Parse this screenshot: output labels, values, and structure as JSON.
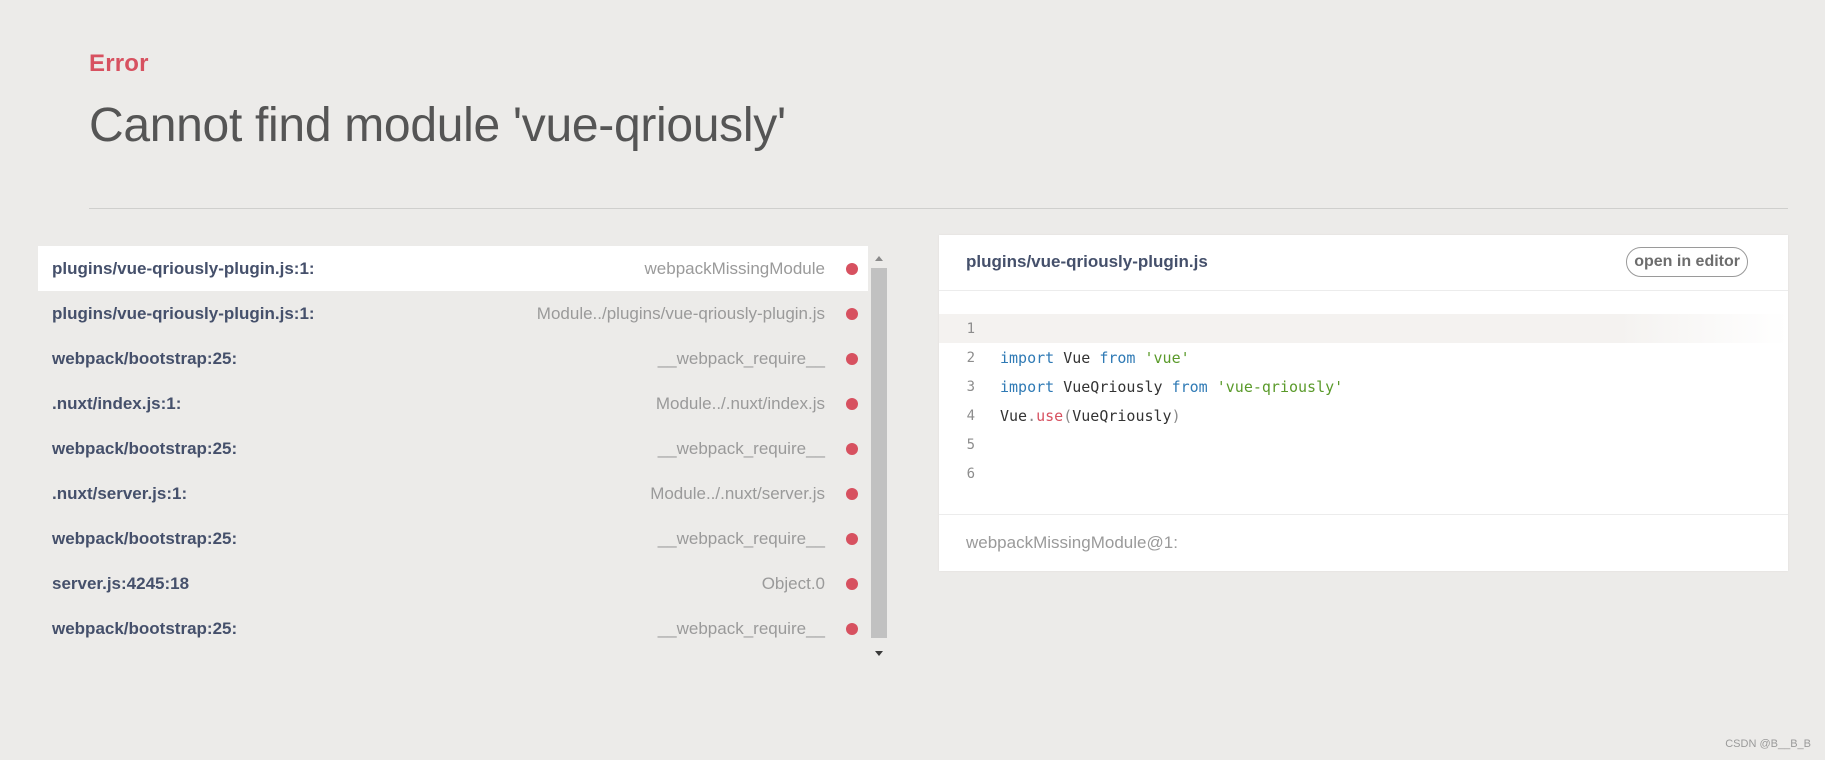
{
  "error": {
    "label": "Error",
    "message": "Cannot find module 'vue-qriously'"
  },
  "stack": [
    {
      "file": "plugins/vue-qriously-plugin.js:1:",
      "fn": "webpackMissingModule",
      "active": true
    },
    {
      "file": "plugins/vue-qriously-plugin.js:1:",
      "fn": "Module../plugins/vue-qriously-plugin.js",
      "active": false
    },
    {
      "file": "webpack/bootstrap:25:",
      "fn": "__webpack_require__",
      "active": false
    },
    {
      "file": ".nuxt/index.js:1:",
      "fn": "Module../.nuxt/index.js",
      "active": false
    },
    {
      "file": "webpack/bootstrap:25:",
      "fn": "__webpack_require__",
      "active": false
    },
    {
      "file": ".nuxt/server.js:1:",
      "fn": "Module../.nuxt/server.js",
      "active": false
    },
    {
      "file": "webpack/bootstrap:25:",
      "fn": "__webpack_require__",
      "active": false
    },
    {
      "file": "server.js:4245:18",
      "fn": "Object.0",
      "active": false
    },
    {
      "file": "webpack/bootstrap:25:",
      "fn": "__webpack_require__",
      "active": false
    }
  ],
  "code": {
    "filename": "plugins/vue-qriously-plugin.js",
    "open_editor_label": "open in editor",
    "lines": [
      {
        "no": "1",
        "tokens": []
      },
      {
        "no": "2",
        "tokens": [
          {
            "t": "import",
            "c": "kw"
          },
          {
            "t": " Vue ",
            "c": ""
          },
          {
            "t": "from",
            "c": "kw"
          },
          {
            "t": " ",
            "c": ""
          },
          {
            "t": "'vue'",
            "c": "str"
          }
        ]
      },
      {
        "no": "3",
        "tokens": [
          {
            "t": "import",
            "c": "kw"
          },
          {
            "t": " VueQriously ",
            "c": ""
          },
          {
            "t": "from",
            "c": "kw"
          },
          {
            "t": " ",
            "c": ""
          },
          {
            "t": "'vue-qriously'",
            "c": "str"
          }
        ]
      },
      {
        "no": "4",
        "tokens": [
          {
            "t": "Vue",
            "c": ""
          },
          {
            "t": ".",
            "c": "punc"
          },
          {
            "t": "use",
            "c": "fn"
          },
          {
            "t": "(",
            "c": "punc"
          },
          {
            "t": "VueQriously",
            "c": ""
          },
          {
            "t": ")",
            "c": "punc"
          }
        ]
      },
      {
        "no": "5",
        "tokens": []
      },
      {
        "no": "6",
        "tokens": []
      }
    ],
    "footer": "webpackMissingModule@1:"
  },
  "watermark": "CSDN @B__B_B",
  "colors": {
    "error_red": "#d75160",
    "keyword_blue": "#2f7ab5",
    "string_green": "#5a9a2a",
    "background": "#ecebe9"
  }
}
